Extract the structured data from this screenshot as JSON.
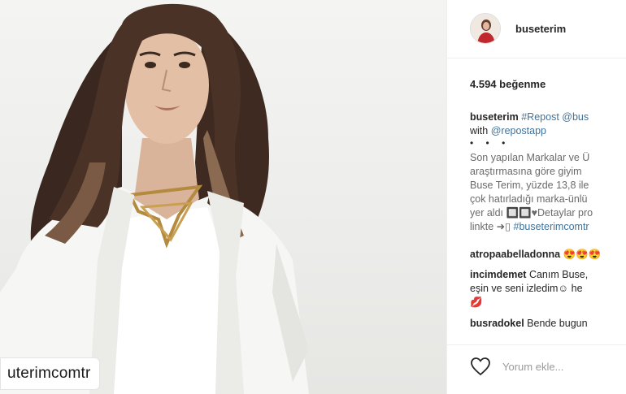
{
  "photo": {
    "watermark_text": "uterimcomtr"
  },
  "post": {
    "username": "buseterim",
    "likes": "4.594 beğenme",
    "caption": {
      "username": "buseterim",
      "line1_tags": "#Repost @bus",
      "line2_prefix": "with",
      "line2_tag": "@repostapp",
      "dots": "• • •",
      "lines": [
        "Son yapılan Markalar ve Ü",
        "araştırmasına göre giyim",
        "Buse Terim, yüzde 13,8 ile",
        "çok hatırladığı marka-ünlü",
        "yer aldı 🔲🔲♥Detaylar pro"
      ],
      "last_line_prefix": "linkte ➜▯",
      "last_line_tag": "#buseterimcomtr"
    },
    "comments": [
      {
        "username": "atropaabelladonna",
        "text": "😍😍😍"
      },
      {
        "username": "incimdemet",
        "text": "Canım Buse,",
        "text2": "eşin ve seni izledim☺ he"
      },
      {
        "username": "busradokel",
        "text": "Bende bugun"
      }
    ],
    "lips_emoji": "💋",
    "add_comment_placeholder": "Yorum ekle..."
  },
  "icons": {
    "like": "heart-outline-icon"
  }
}
